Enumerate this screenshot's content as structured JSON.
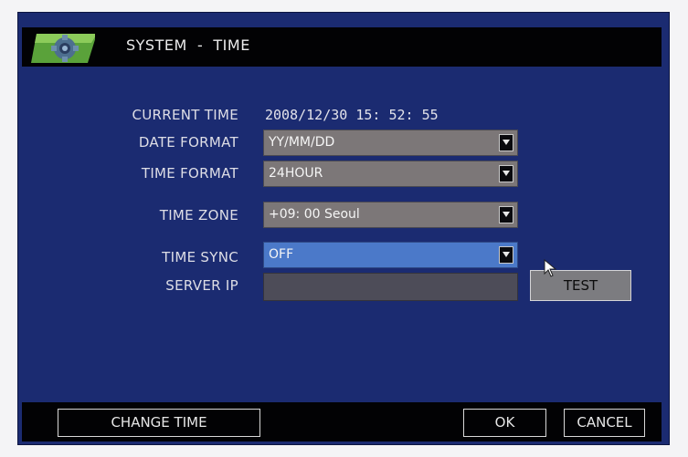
{
  "header": {
    "title": "SYSTEM  -  TIME",
    "icon": "gear-icon"
  },
  "fields": {
    "current_time": {
      "label": "CURRENT TIME",
      "value": "2008/12/30 15: 52: 55"
    },
    "date_format": {
      "label": "DATE FORMAT",
      "value": "YY/MM/DD"
    },
    "time_format": {
      "label": "TIME FORMAT",
      "value": "24HOUR"
    },
    "time_zone": {
      "label": "TIME ZONE",
      "value": "+09: 00 Seoul"
    },
    "time_sync": {
      "label": "TIME SYNC",
      "value": "OFF"
    },
    "server_ip": {
      "label": "SERVER IP",
      "value": ""
    }
  },
  "buttons": {
    "test": "TEST",
    "change_time": "CHANGE TIME",
    "ok": "OK",
    "cancel": "CANCEL"
  },
  "colors": {
    "background": "#1b2b71",
    "bar": "#020204",
    "select": "#7c7778",
    "select_active": "#4b79c9"
  }
}
